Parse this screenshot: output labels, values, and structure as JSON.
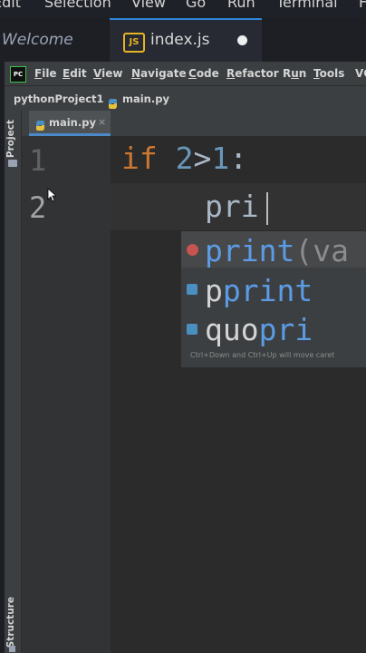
{
  "vscode": {
    "menu": [
      "Edit",
      "Selection",
      "View",
      "Go",
      "Run",
      "Terminal",
      "Help"
    ],
    "tabs": [
      {
        "label": "Welcome"
      },
      {
        "label": "index.js",
        "icon_text": "JS"
      }
    ]
  },
  "pycharm": {
    "logo": "PC",
    "menu": [
      {
        "pre": "",
        "u": "F",
        "post": "ile"
      },
      {
        "pre": "",
        "u": "E",
        "post": "dit"
      },
      {
        "pre": "",
        "u": "V",
        "post": "iew"
      },
      {
        "pre": "",
        "u": "N",
        "post": "avigate"
      },
      {
        "pre": "",
        "u": "C",
        "post": "ode"
      },
      {
        "pre": "",
        "u": "R",
        "post": "efactor"
      },
      {
        "pre": "R",
        "u": "u",
        "post": "n"
      },
      {
        "pre": "",
        "u": "T",
        "post": "ools"
      },
      {
        "pre": "VC",
        "u": "",
        "post": ""
      }
    ],
    "breadcrumb": {
      "project": "pythonProject1",
      "file": "main.py"
    },
    "tool_windows": {
      "left_top": "Project",
      "left_bottom": "Structure"
    },
    "editor_tab": {
      "label": "main.py",
      "close": "×"
    },
    "line_numbers": [
      "1",
      "2"
    ],
    "code": {
      "line1": {
        "keyword": "if",
        "left": "2",
        "op": ">",
        "right": "1",
        "colon": ":"
      },
      "line2": "pri"
    },
    "autocomplete": {
      "items": [
        {
          "pre": "",
          "match": "print",
          "post": "(va",
          "icon": "function-icon"
        },
        {
          "pre": "p",
          "match": "print",
          "post": "",
          "icon": "module-icon"
        },
        {
          "pre": "quo",
          "match": "pri",
          "post": "",
          "icon": "module-icon"
        }
      ],
      "hint": "Ctrl+Down and Ctrl+Up will move caret"
    }
  },
  "colors": {
    "keyword": "#cc7832",
    "number": "#6897bb",
    "match": "#5c9ce6",
    "vscode_tab_accent": "#2f86d8"
  }
}
